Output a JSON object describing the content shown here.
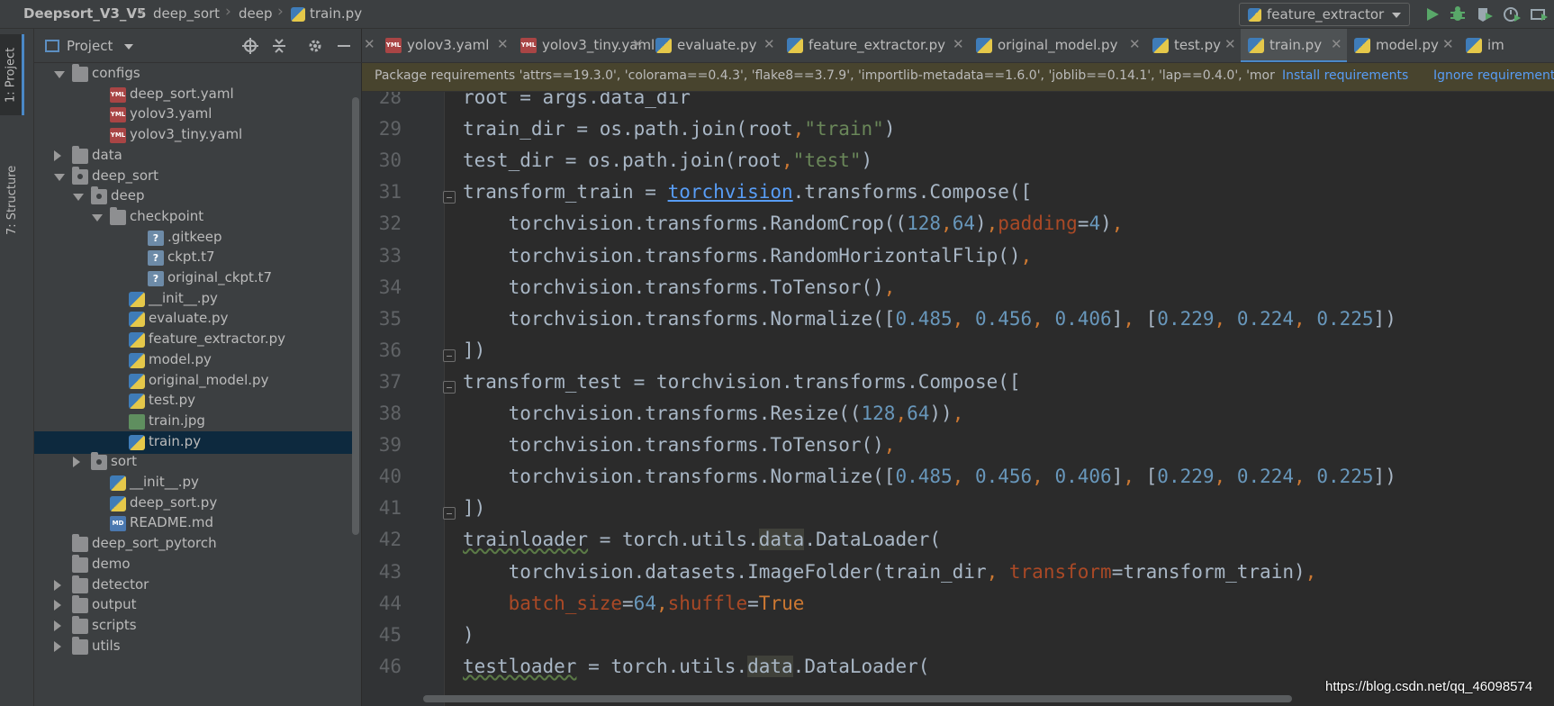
{
  "breadcrumb": [
    {
      "label": "Deepsort_V3_V5"
    },
    {
      "label": "deep_sort"
    },
    {
      "label": "deep"
    },
    {
      "label": "train.py"
    }
  ],
  "run_config": {
    "label": "feature_extractor",
    "icon": "python-icon"
  },
  "toolbar": {
    "run_icon": "run-icon",
    "debug_icon": "debug-icon",
    "coverage_icon": "coverage-icon",
    "profile_icon": "profile-icon",
    "more_icon": "more-icon"
  },
  "tool_strip": {
    "project_tab": "1: Project",
    "structure_tab": "7: Structure"
  },
  "project_panel": {
    "title": "Project",
    "tree": [
      {
        "label": "configs",
        "depth": 1,
        "icon": "folder",
        "expand": "down"
      },
      {
        "label": "deep_sort.yaml",
        "depth": 3,
        "icon": "yml"
      },
      {
        "label": "yolov3.yaml",
        "depth": 3,
        "icon": "yml"
      },
      {
        "label": "yolov3_tiny.yaml",
        "depth": 3,
        "icon": "yml"
      },
      {
        "label": "data",
        "depth": 1,
        "icon": "folder",
        "expand": "right"
      },
      {
        "label": "deep_sort",
        "depth": 1,
        "icon": "pkg",
        "expand": "down"
      },
      {
        "label": "deep",
        "depth": 2,
        "icon": "pkg",
        "expand": "down"
      },
      {
        "label": "checkpoint",
        "depth": 3,
        "icon": "folder",
        "expand": "down"
      },
      {
        "label": ".gitkeep",
        "depth": 5,
        "icon": "unk"
      },
      {
        "label": "ckpt.t7",
        "depth": 5,
        "icon": "unk"
      },
      {
        "label": "original_ckpt.t7",
        "depth": 5,
        "icon": "unk"
      },
      {
        "label": "__init__.py",
        "depth": 4,
        "icon": "py"
      },
      {
        "label": "evaluate.py",
        "depth": 4,
        "icon": "py"
      },
      {
        "label": "feature_extractor.py",
        "depth": 4,
        "icon": "py"
      },
      {
        "label": "model.py",
        "depth": 4,
        "icon": "py"
      },
      {
        "label": "original_model.py",
        "depth": 4,
        "icon": "py"
      },
      {
        "label": "test.py",
        "depth": 4,
        "icon": "py"
      },
      {
        "label": "train.jpg",
        "depth": 4,
        "icon": "img"
      },
      {
        "label": "train.py",
        "depth": 4,
        "icon": "py",
        "selected": true
      },
      {
        "label": "sort",
        "depth": 2,
        "icon": "pkg",
        "expand": "right"
      },
      {
        "label": "__init__.py",
        "depth": 3,
        "icon": "py"
      },
      {
        "label": "deep_sort.py",
        "depth": 3,
        "icon": "py"
      },
      {
        "label": "README.md",
        "depth": 3,
        "icon": "md"
      },
      {
        "label": "deep_sort_pytorch",
        "depth": 1,
        "icon": "folder"
      },
      {
        "label": "demo",
        "depth": 1,
        "icon": "folder"
      },
      {
        "label": "detector",
        "depth": 1,
        "icon": "folder",
        "expand": "right"
      },
      {
        "label": "output",
        "depth": 1,
        "icon": "folder",
        "expand": "right"
      },
      {
        "label": "scripts",
        "depth": 1,
        "icon": "folder",
        "expand": "right"
      },
      {
        "label": "utils",
        "depth": 1,
        "icon": "folder",
        "expand": "right"
      }
    ]
  },
  "tabs": [
    {
      "label": "yolov3.yaml",
      "icon": "yml"
    },
    {
      "label": "yolov3_tiny.yaml",
      "icon": "yml"
    },
    {
      "label": "evaluate.py",
      "icon": "py"
    },
    {
      "label": "feature_extractor.py",
      "icon": "py"
    },
    {
      "label": "original_model.py",
      "icon": "py"
    },
    {
      "label": "test.py",
      "icon": "py"
    },
    {
      "label": "train.py",
      "icon": "py",
      "active": true
    },
    {
      "label": "model.py",
      "icon": "py"
    },
    {
      "label": "im",
      "icon": "py"
    }
  ],
  "banner": {
    "text": "Package requirements 'attrs==19.3.0', 'colorama==0.4.3', 'flake8==3.7.9', 'importlib-metadata==1.6.0', 'joblib==0.14.1', 'lap==0.4.0', 'mor",
    "install_label": "Install requirements",
    "ignore_label": "Ignore requirements"
  },
  "editor": {
    "lines": [
      {
        "n": "28",
        "tokens": [
          [
            "",
            "root = args.data_dir"
          ]
        ]
      },
      {
        "n": "29",
        "tokens": [
          [
            "",
            "train_dir = os.path.join(root"
          ],
          [
            "kw",
            ","
          ],
          [
            "str",
            "\"train\""
          ],
          [
            "",
            ")"
          ]
        ]
      },
      {
        "n": "30",
        "tokens": [
          [
            "",
            "test_dir = os.path.join(root"
          ],
          [
            "kw",
            ","
          ],
          [
            "str",
            "\"test\""
          ],
          [
            "",
            ")"
          ]
        ]
      },
      {
        "n": "31",
        "fold": true,
        "tokens": [
          [
            "",
            "transform_train = "
          ],
          [
            "mod",
            "torchvision"
          ],
          [
            "",
            ".transforms.Compose(["
          ]
        ]
      },
      {
        "n": "32",
        "tokens": [
          [
            "",
            "    torchvision.transforms.RandomCrop(("
          ],
          [
            "num",
            "128"
          ],
          [
            "kw",
            ","
          ],
          [
            "num",
            "64"
          ],
          [
            "",
            ")"
          ],
          [
            "kw",
            ","
          ],
          [
            "param",
            "padding"
          ],
          [
            "",
            "="
          ],
          [
            "num",
            "4"
          ],
          [
            "",
            ")"
          ],
          [
            "kw",
            ","
          ]
        ]
      },
      {
        "n": "33",
        "tokens": [
          [
            "",
            "    torchvision.transforms.RandomHorizontalFlip()"
          ],
          [
            "kw",
            ","
          ]
        ]
      },
      {
        "n": "34",
        "tokens": [
          [
            "",
            "    torchvision.transforms.ToTensor()"
          ],
          [
            "kw",
            ","
          ]
        ]
      },
      {
        "n": "35",
        "tokens": [
          [
            "",
            "    torchvision.transforms.Normalize(["
          ],
          [
            "num",
            "0.485"
          ],
          [
            "kw",
            ", "
          ],
          [
            "num",
            "0.456"
          ],
          [
            "kw",
            ", "
          ],
          [
            "num",
            "0.406"
          ],
          [
            "",
            "]"
          ],
          [
            "kw",
            ", "
          ],
          [
            "",
            "["
          ],
          [
            "num",
            "0.229"
          ],
          [
            "kw",
            ", "
          ],
          [
            "num",
            "0.224"
          ],
          [
            "kw",
            ", "
          ],
          [
            "num",
            "0.225"
          ],
          [
            "",
            "])"
          ]
        ]
      },
      {
        "n": "36",
        "fold": true,
        "tokens": [
          [
            "",
            "])"
          ]
        ]
      },
      {
        "n": "37",
        "fold": true,
        "tokens": [
          [
            "",
            "transform_test = torchvision.transforms.Compose(["
          ]
        ]
      },
      {
        "n": "38",
        "tokens": [
          [
            "",
            "    torchvision.transforms.Resize(("
          ],
          [
            "num",
            "128"
          ],
          [
            "kw",
            ","
          ],
          [
            "num",
            "64"
          ],
          [
            "",
            "))"
          ],
          [
            "kw",
            ","
          ]
        ]
      },
      {
        "n": "39",
        "tokens": [
          [
            "",
            "    torchvision.transforms.ToTensor()"
          ],
          [
            "kw",
            ","
          ]
        ]
      },
      {
        "n": "40",
        "tokens": [
          [
            "",
            "    torchvision.transforms.Normalize(["
          ],
          [
            "num",
            "0.485"
          ],
          [
            "kw",
            ", "
          ],
          [
            "num",
            "0.456"
          ],
          [
            "kw",
            ", "
          ],
          [
            "num",
            "0.406"
          ],
          [
            "",
            "]"
          ],
          [
            "kw",
            ", "
          ],
          [
            "",
            "["
          ],
          [
            "num",
            "0.229"
          ],
          [
            "kw",
            ", "
          ],
          [
            "num",
            "0.224"
          ],
          [
            "kw",
            ", "
          ],
          [
            "num",
            "0.225"
          ],
          [
            "",
            "])"
          ]
        ]
      },
      {
        "n": "41",
        "fold": true,
        "tokens": [
          [
            "",
            "])"
          ]
        ]
      },
      {
        "n": "42",
        "tokens": [
          [
            "weak",
            "trainloader"
          ],
          [
            "",
            " = torch.utils."
          ],
          [
            "hl",
            "data"
          ],
          [
            "",
            ".DataLoader("
          ]
        ]
      },
      {
        "n": "43",
        "tokens": [
          [
            "",
            "    torchvision.datasets.ImageFolder(train_dir"
          ],
          [
            "kw",
            ", "
          ],
          [
            "param",
            "transform"
          ],
          [
            "",
            "=transform_train)"
          ],
          [
            "kw",
            ","
          ]
        ]
      },
      {
        "n": "44",
        "tokens": [
          [
            "",
            "    "
          ],
          [
            "param",
            "batch_size"
          ],
          [
            "",
            "="
          ],
          [
            "num",
            "64"
          ],
          [
            "kw",
            ","
          ],
          [
            "param",
            "shuffle"
          ],
          [
            "",
            "="
          ],
          [
            "kw",
            "True"
          ]
        ]
      },
      {
        "n": "45",
        "tokens": [
          [
            "",
            ")"
          ]
        ]
      },
      {
        "n": "46",
        "tokens": [
          [
            "weak",
            "testloader"
          ],
          [
            "",
            " = torch.utils."
          ],
          [
            "hl",
            "data"
          ],
          [
            "",
            ".DataLoader("
          ]
        ]
      }
    ]
  },
  "watermark": "https://blog.csdn.net/qq_46098574",
  "colors": {
    "accent": "#4a88c7",
    "keyword": "#cc7832",
    "string": "#6a8759",
    "number": "#6897bb",
    "parameter": "#aa4926",
    "link": "#589df6",
    "banner_bg": "#48442e"
  }
}
